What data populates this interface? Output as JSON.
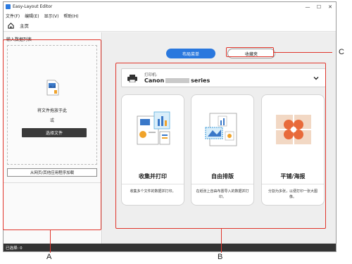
{
  "window": {
    "title": "Easy-Layout Editor",
    "min": "—",
    "max": "☐",
    "close": "✕"
  },
  "menu": [
    "文件(F)",
    "编辑(E)",
    "显示(V)",
    "帮助(H)"
  ],
  "home": {
    "label": "主页"
  },
  "left_panel": {
    "title": "输入数据列表",
    "drop_text": "将文件拖放于此",
    "or_text": "或",
    "select_button": "选择文件",
    "web_load_button": "从网页/其他应用程序加载"
  },
  "status": {
    "text": "已选择: 0"
  },
  "tabs": {
    "layout_menu": "布局菜单",
    "favorites": "收藏夹"
  },
  "printer": {
    "label": "打印机:",
    "brand": "Canon",
    "series": "series"
  },
  "cards": [
    {
      "title": "收集并打印",
      "desc": "收集多个文件的数据并打印。"
    },
    {
      "title": "自由排版",
      "desc": "在纸张上自由布置导入的数据并打印。"
    },
    {
      "title": "平铺/海报",
      "desc": "分割为多张，以便打印一张大图像。"
    }
  ],
  "callouts": {
    "a": "A",
    "b": "B",
    "c": "C"
  },
  "colors": {
    "accent": "#2a78de",
    "highlight": "#e0352b",
    "status_bar": "#333333"
  }
}
